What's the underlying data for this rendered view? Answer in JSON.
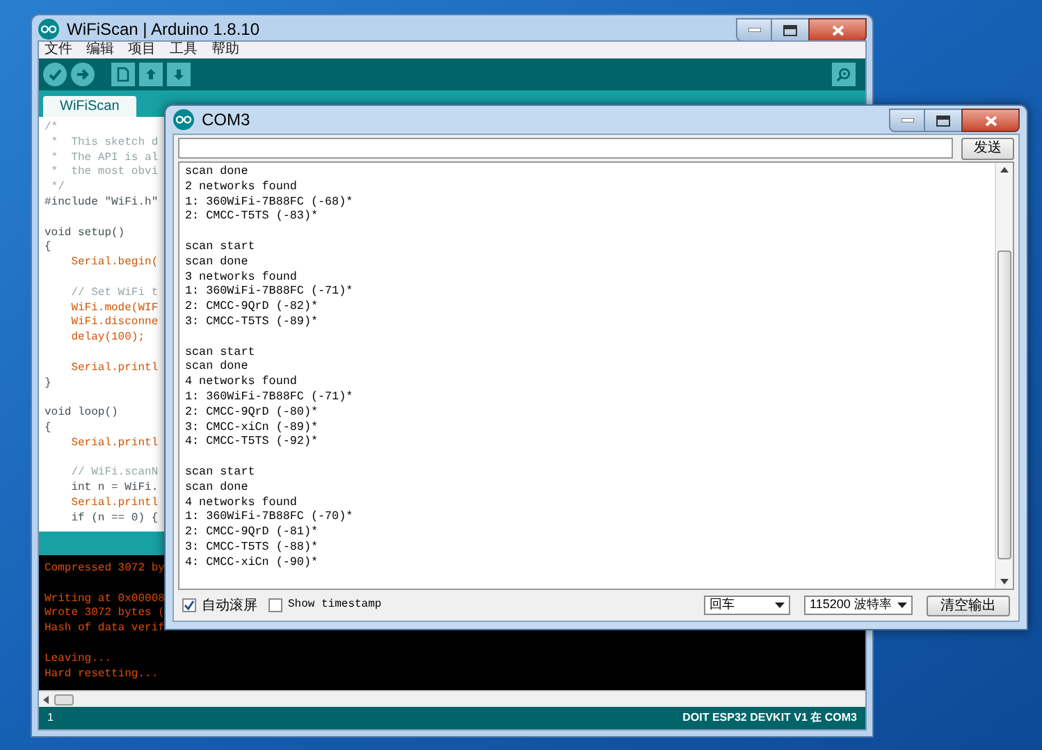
{
  "ide_window": {
    "title": "WiFiScan | Arduino 1.8.10",
    "menu": [
      "文件",
      "编辑",
      "项目",
      "工具",
      "帮助"
    ],
    "tabs": [
      {
        "label": "WiFiScan",
        "selected": true
      }
    ],
    "code_blocks": [
      [
        {
          "text": "/*",
          "kind": "comment"
        },
        {
          "text": " *  This sketch d",
          "kind": "comment"
        },
        {
          "text": " *  The API is al",
          "kind": "comment"
        },
        {
          "text": " *  the most obvi",
          "kind": "comment"
        },
        {
          "text": " */",
          "kind": "comment"
        },
        {
          "text": "#include \"WiFi.h\"",
          "kind": "code"
        }
      ],
      [
        {
          "text": "void setup()",
          "kind": "code"
        },
        {
          "text": "{",
          "kind": "code"
        },
        {
          "text": "    Serial.begin(",
          "kind": "call"
        }
      ],
      [
        {
          "text": "    // Set WiFi t",
          "kind": "comment"
        },
        {
          "text": "    WiFi.mode(WIF",
          "kind": "call"
        },
        {
          "text": "    WiFi.disconne",
          "kind": "call"
        },
        {
          "text": "    delay(100);",
          "kind": "call"
        }
      ],
      [
        {
          "text": "    Serial.printl",
          "kind": "call"
        },
        {
          "text": "}",
          "kind": "code"
        }
      ],
      [
        {
          "text": "void loop()",
          "kind": "code"
        },
        {
          "text": "{",
          "kind": "code"
        },
        {
          "text": "    Serial.printl",
          "kind": "call"
        }
      ],
      [
        {
          "text": "    // WiFi.scanN",
          "kind": "comment"
        },
        {
          "text": "    int n = WiFi.",
          "kind": "code"
        },
        {
          "text": "    Serial.printl",
          "kind": "call"
        },
        {
          "text": "    if (n == 0) {",
          "kind": "code"
        }
      ]
    ],
    "console_blocks": [
      [
        "Compressed 3072 by"
      ],
      [
        "Writing at 0x00008",
        "Wrote 3072 bytes (",
        "Hash of data verif"
      ],
      [
        "Leaving...",
        "Hard resetting..."
      ]
    ],
    "line_number": "1",
    "board_status": "DOIT ESP32 DEVKIT V1 在 COM3"
  },
  "serial_monitor": {
    "title": "COM3",
    "send_button": "发送",
    "output_blocks": [
      [
        "scan done",
        "2 networks found",
        "1: 360WiFi-7B88FC (-68)*",
        "2: CMCC-T5TS (-83)*"
      ],
      [
        "scan start",
        "scan done",
        "3 networks found",
        "1: 360WiFi-7B88FC (-71)*",
        "2: CMCC-9QrD (-82)*",
        "3: CMCC-T5TS (-89)*"
      ],
      [
        "scan start",
        "scan done",
        "4 networks found",
        "1: 360WiFi-7B88FC (-71)*",
        "2: CMCC-9QrD (-80)*",
        "3: CMCC-xiCn (-89)*",
        "4: CMCC-T5TS (-92)*"
      ],
      [
        "scan start",
        "scan done",
        "4 networks found",
        "1: 360WiFi-7B88FC (-70)*",
        "2: CMCC-9QrD (-81)*",
        "3: CMCC-T5TS (-88)*",
        "4: CMCC-xiCn (-90)*"
      ]
    ],
    "autoscroll": {
      "label": "自动滚屏",
      "checked": true
    },
    "timestamp": {
      "label": "Show timestamp",
      "checked": false
    },
    "line_ending": "回车",
    "baud_rate": "115200 波特率",
    "clear_button": "清空输出"
  }
}
